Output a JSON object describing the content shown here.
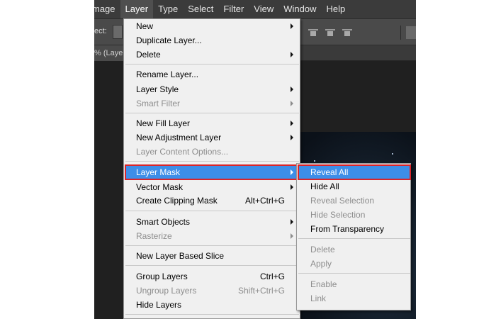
{
  "menubar": {
    "items": [
      "mage",
      "Layer",
      "Type",
      "Select",
      "Filter",
      "View",
      "Window",
      "Help"
    ],
    "active": "Layer"
  },
  "options_bar": {
    "label": "ect:"
  },
  "doc_tab": {
    "label": "% (Laye"
  },
  "layer_menu": {
    "items": [
      {
        "label": "New",
        "submenu": true
      },
      {
        "label": "Duplicate Layer..."
      },
      {
        "label": "Delete",
        "submenu": true
      },
      {
        "label": "Rename Layer..."
      },
      {
        "label": "Layer Style",
        "submenu": true
      },
      {
        "label": "Smart Filter",
        "submenu": true,
        "disabled": true
      },
      {
        "label": "New Fill Layer",
        "submenu": true
      },
      {
        "label": "New Adjustment Layer",
        "submenu": true
      },
      {
        "label": "Layer Content Options...",
        "disabled": true
      },
      {
        "label": "Layer Mask",
        "submenu": true,
        "highlighted": true
      },
      {
        "label": "Vector Mask",
        "submenu": true
      },
      {
        "label": "Create Clipping Mask",
        "shortcut": "Alt+Ctrl+G"
      },
      {
        "label": "Smart Objects",
        "submenu": true
      },
      {
        "label": "Rasterize",
        "submenu": true,
        "disabled": true
      },
      {
        "label": "New Layer Based Slice"
      },
      {
        "label": "Group Layers",
        "shortcut": "Ctrl+G"
      },
      {
        "label": "Ungroup Layers",
        "shortcut": "Shift+Ctrl+G",
        "disabled": true
      },
      {
        "label": "Hide Layers"
      }
    ]
  },
  "layer_mask_submenu": {
    "items": [
      {
        "label": "Reveal All",
        "highlighted": true
      },
      {
        "label": "Hide All"
      },
      {
        "label": "Reveal Selection",
        "disabled": true
      },
      {
        "label": "Hide Selection",
        "disabled": true
      },
      {
        "label": "From Transparency"
      },
      {
        "label": "Delete",
        "disabled": true
      },
      {
        "label": "Apply",
        "disabled": true
      },
      {
        "label": "Enable",
        "disabled": true
      },
      {
        "label": "Link",
        "disabled": true
      }
    ]
  },
  "colors": {
    "menu_bg": "#f0f0f0",
    "highlight": "#3d8ee8",
    "highlight_outline": "#d9252a",
    "menubar_bg": "#3b3b3b"
  }
}
